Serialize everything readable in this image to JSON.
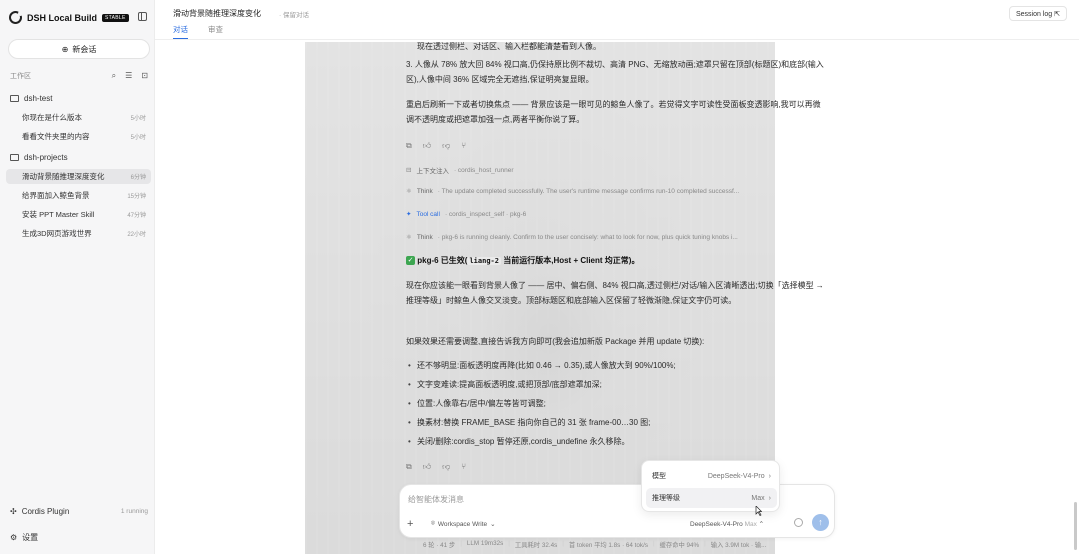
{
  "sidebar": {
    "app_name": "DSH Local Build",
    "badge": "STABLE",
    "new_chat_label": "新会话",
    "workspace_label": "工作区",
    "folders": [
      {
        "name": "dsh-test",
        "items": [
          {
            "title": "你现在是什么版本",
            "time": "5小时"
          },
          {
            "title": "看看文件夹里的内容",
            "time": "5小时"
          }
        ]
      },
      {
        "name": "dsh-projects",
        "items": [
          {
            "title": "滑动背景随推理深度变化",
            "time": "6分钟"
          },
          {
            "title": "给界面加入鲸鱼背景",
            "time": "15分钟"
          },
          {
            "title": "安装 PPT Master Skill",
            "time": "47分钟"
          },
          {
            "title": "生成3D网页游戏世界",
            "time": "22小时"
          }
        ]
      }
    ],
    "plugin_label": "Cordis Plugin",
    "plugin_status": "1 running",
    "settings_label": "设置"
  },
  "topbar": {
    "title": "滑动背景随推理深度变化",
    "subtitle": "· 保留对话",
    "tabs": [
      {
        "label": "对话"
      },
      {
        "label": "审查"
      }
    ],
    "session_log": "Session log ⇱"
  },
  "conversation": {
    "intro_line": "现在透过侧栏、对话区、输入栏都能清楚看到人像。",
    "item3": "3. 人像从 78% 放大回 84% 视口高,仍保持原比例不裁切、高清 PNG、无缩放动画;遮罩只留在顶部(标题区)和底部(输入区),人像中间 36% 区域完全无遮挡,保证明亮复显眼。",
    "para1": "重启后刷新一下或者切换焦点 —— 背景应该是一眼可见的鲸鱼人像了。若觉得文字可读性受面板变透影响,我可以再微调不透明度或把遮罩加强一点,两者平衡你说了算。",
    "trace1_label": "上下文注入",
    "trace1_text": "· cordis_host_runner",
    "trace2_label": "Think",
    "trace2_text": "· The update completed successfully. The user's runtime message confirms run-10 completed successf...",
    "trace3_label": "Tool call",
    "trace3_text": "· cordis_inspect_self · pkg-6",
    "trace4_label": "Think",
    "trace4_text": "· pkg-6 is running cleanly. Confirm to the user concisely: what to look for now, plus quick tuning knobs i...",
    "status_prefix": "pkg-6 已生效(",
    "status_code": "liang-2",
    "status_suffix": "当前运行版本,Host + Client 均正常)。",
    "para2": "现在你应该能一眼看到背景人像了 —— 居中、偏右侧、84% 视口高,透过侧栏/对话/输入区清晰透出;切换「选择模型 → 推理等级」时鲸鱼人像交叉淡变。顶部标题区和底部输入区保留了轻微渐隐,保证文字仍可读。",
    "para3": "如果效果还需要调整,直接告诉我方向即可(我会追加新版 Package 并用 update 切换):",
    "bullets": [
      "还不够明显:面板透明度再降(比如 0.46 → 0.35),或人像放大到 90%/100%;",
      "文字变难读:提高面板透明度,或把顶部/底部遮罩加深;",
      "位置:人像靠右/居中/偏左等皆可调整;",
      "换素材:替换 FRAME_BASE 指向你自己的 31 张 frame-00…30 图;",
      "关闭/删除:cordis_stop 暂停还原,cordis_undefine 永久移除。"
    ],
    "action_icons": [
      "copy-icon",
      "thumb-up-icon",
      "thumb-down-icon",
      "fork-icon"
    ]
  },
  "composer": {
    "placeholder": "给智能体发消息",
    "workspace_mode": "Workspace Write",
    "model": "DeepSeek-V4-Pro",
    "level": "Max",
    "popover": [
      {
        "label": "模型",
        "value": "DeepSeek-V4-Pro"
      },
      {
        "label": "推理等级",
        "value": "Max"
      }
    ]
  },
  "statusbar": [
    "6 轮 · 41 步",
    "LLM 19m32s",
    "工具耗时 32.4s",
    "首 token 平均 1.8s · 64 tok/s",
    "缓存命中 94%",
    "输入 3.9M tok · 输..."
  ],
  "colors": {
    "accent": "#2b6de0",
    "send": "#9fbfea",
    "success": "#3da651"
  }
}
